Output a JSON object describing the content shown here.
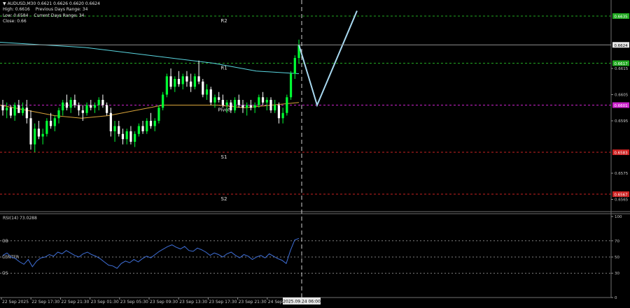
{
  "header": {
    "title": "AUDUSD,M30",
    "ohlc": "0.6621 0.6626 0.6620 0.6624",
    "high_label": "High: 0.6616",
    "prev_range_label": "Previous Days Range: 34",
    "low_label": "Low: 0.6584",
    "curr_range_label": "Current Days Range: 34",
    "close_label": "Close: 0.66"
  },
  "levels": [
    {
      "label": "R2",
      "price": 0.6635,
      "price_label": "0.6635",
      "color": "#22aa22"
    },
    {
      "label": "R1",
      "price": 0.6617,
      "price_label": "0.6617",
      "color": "#22aa22"
    },
    {
      "label": "Pivot",
      "price": 0.6601,
      "price_label": "0.6601",
      "color": "#cc22cc"
    },
    {
      "label": "S1",
      "price": 0.6583,
      "price_label": "0.6583",
      "color": "#cc2222"
    },
    {
      "label": "S2",
      "price": 0.6567,
      "price_label": "0.6567",
      "color": "#cc2222"
    }
  ],
  "current_price": {
    "value": 0.6624,
    "label": "0.6624"
  },
  "price_axis_ticks": [
    {
      "value": 0.6615,
      "label": "0.6615"
    },
    {
      "value": 0.6605,
      "label": "0.6605"
    },
    {
      "value": 0.6595,
      "label": "0.6595"
    },
    {
      "value": 0.6575,
      "label": "0.6575"
    },
    {
      "value": 0.6565,
      "label": "0.6565"
    }
  ],
  "time_axis": [
    "22 Sep 2025",
    "22 Sep 17:30",
    "22 Sep 21:30",
    "23 Sep 01:30",
    "23 Sep 05:30",
    "23 Sep 09:30",
    "23 Sep 13:30",
    "23 Sep 17:30",
    "23 Sep 21:30",
    "24 Sep"
  ],
  "cursor_time_label": "2025.09.24 06:00",
  "rsi": {
    "label": "RSI(14) 73.0288",
    "levels": [
      {
        "name": "OB",
        "value": 70
      },
      {
        "name": "CENTER",
        "value": 50
      },
      {
        "name": "OS",
        "value": 30
      }
    ],
    "axis_ticks": [
      100,
      70,
      50,
      30,
      0
    ]
  },
  "colors": {
    "bull": "#00ff33",
    "bear": "#ffffff",
    "ma_slow": "#5ad6e0",
    "ma_fast": "#d9a43a",
    "projection": "#a8d8f0",
    "rsi_line": "#3f6fd8",
    "cursor": "#d0d0d0"
  },
  "chart_data": {
    "type": "candlestick",
    "symbol": "AUDUSD",
    "timeframe": "M30",
    "ylim": [
      0.6561,
      0.664
    ],
    "candles": [
      [
        0.6601,
        0.6603,
        0.6597,
        0.6599
      ],
      [
        0.6599,
        0.6602,
        0.6596,
        0.66
      ],
      [
        0.66,
        0.6601,
        0.6596,
        0.6597
      ],
      [
        0.6597,
        0.6602,
        0.6595,
        0.6601
      ],
      [
        0.6601,
        0.6603,
        0.6598,
        0.6598
      ],
      [
        0.6598,
        0.6602,
        0.6597,
        0.66
      ],
      [
        0.66,
        0.6603,
        0.6594,
        0.6596
      ],
      [
        0.6596,
        0.6599,
        0.6584,
        0.6586
      ],
      [
        0.6586,
        0.6594,
        0.6583,
        0.6592
      ],
      [
        0.6592,
        0.6595,
        0.6588,
        0.6589
      ],
      [
        0.6589,
        0.6592,
        0.6586,
        0.659
      ],
      [
        0.659,
        0.6596,
        0.6589,
        0.6595
      ],
      [
        0.6595,
        0.6598,
        0.6592,
        0.6593
      ],
      [
        0.6593,
        0.6597,
        0.6591,
        0.6596
      ],
      [
        0.6596,
        0.66,
        0.6594,
        0.6599
      ],
      [
        0.6599,
        0.6603,
        0.6597,
        0.6602
      ],
      [
        0.6602,
        0.6605,
        0.6599,
        0.66
      ],
      [
        0.66,
        0.6604,
        0.6598,
        0.6603
      ],
      [
        0.6603,
        0.6605,
        0.66,
        0.6601
      ],
      [
        0.6601,
        0.6602,
        0.6597,
        0.6599
      ],
      [
        0.6599,
        0.6601,
        0.6595,
        0.6598
      ],
      [
        0.6598,
        0.6602,
        0.6597,
        0.6601
      ],
      [
        0.6601,
        0.6603,
        0.6599,
        0.66
      ],
      [
        0.66,
        0.6602,
        0.6598,
        0.6601
      ],
      [
        0.6601,
        0.6604,
        0.6599,
        0.6603
      ],
      [
        0.6603,
        0.6605,
        0.66,
        0.6601
      ],
      [
        0.6601,
        0.6602,
        0.6597,
        0.6598
      ],
      [
        0.6598,
        0.66,
        0.6589,
        0.6591
      ],
      [
        0.6591,
        0.6595,
        0.6587,
        0.6593
      ],
      [
        0.6593,
        0.6595,
        0.6589,
        0.659
      ],
      [
        0.659,
        0.6592,
        0.6586,
        0.6588
      ],
      [
        0.6588,
        0.6592,
        0.6586,
        0.6591
      ],
      [
        0.6591,
        0.6593,
        0.6586,
        0.6587
      ],
      [
        0.6587,
        0.6591,
        0.6585,
        0.659
      ],
      [
        0.659,
        0.6594,
        0.6589,
        0.6593
      ],
      [
        0.6593,
        0.6595,
        0.659,
        0.6591
      ],
      [
        0.6591,
        0.6596,
        0.659,
        0.6595
      ],
      [
        0.6595,
        0.6598,
        0.6592,
        0.6593
      ],
      [
        0.6593,
        0.6596,
        0.6591,
        0.6595
      ],
      [
        0.6595,
        0.6601,
        0.6594,
        0.66
      ],
      [
        0.66,
        0.6606,
        0.6599,
        0.6605
      ],
      [
        0.6605,
        0.6613,
        0.6604,
        0.6612
      ],
      [
        0.6612,
        0.6615,
        0.6607,
        0.6608
      ],
      [
        0.6608,
        0.6612,
        0.6606,
        0.6611
      ],
      [
        0.6611,
        0.6614,
        0.6608,
        0.6609
      ],
      [
        0.6609,
        0.6613,
        0.6607,
        0.6612
      ],
      [
        0.6612,
        0.6614,
        0.6608,
        0.661
      ],
      [
        0.661,
        0.6613,
        0.6606,
        0.6608
      ],
      [
        0.6608,
        0.6613,
        0.6607,
        0.6612
      ],
      [
        0.6612,
        0.6618,
        0.6609,
        0.661
      ],
      [
        0.661,
        0.6611,
        0.6604,
        0.6605
      ],
      [
        0.6605,
        0.6609,
        0.6603,
        0.6607
      ],
      [
        0.6607,
        0.6608,
        0.6601,
        0.6602
      ],
      [
        0.6602,
        0.6605,
        0.66,
        0.6604
      ],
      [
        0.6604,
        0.6606,
        0.6602,
        0.6603
      ],
      [
        0.6603,
        0.6605,
        0.66,
        0.6601
      ],
      [
        0.6601,
        0.6603,
        0.6598,
        0.6602
      ],
      [
        0.6602,
        0.6603,
        0.6598,
        0.6599
      ],
      [
        0.6599,
        0.6604,
        0.6598,
        0.6603
      ],
      [
        0.6603,
        0.6605,
        0.66,
        0.6601
      ],
      [
        0.6601,
        0.6603,
        0.6598,
        0.66
      ],
      [
        0.66,
        0.6602,
        0.6597,
        0.6601
      ],
      [
        0.6601,
        0.6603,
        0.6599,
        0.66
      ],
      [
        0.66,
        0.6602,
        0.6598,
        0.6601
      ],
      [
        0.6601,
        0.6605,
        0.66,
        0.6604
      ],
      [
        0.6604,
        0.6606,
        0.6601,
        0.6602
      ],
      [
        0.6602,
        0.6604,
        0.6599,
        0.6603
      ],
      [
        0.6603,
        0.6604,
        0.6598,
        0.6599
      ],
      [
        0.6599,
        0.6603,
        0.6598,
        0.6601
      ],
      [
        0.6601,
        0.6602,
        0.6594,
        0.6596
      ],
      [
        0.6596,
        0.66,
        0.6594,
        0.6598
      ],
      [
        0.6598,
        0.6605,
        0.6597,
        0.6604
      ],
      [
        0.6604,
        0.6614,
        0.6603,
        0.6613
      ],
      [
        0.6613,
        0.662,
        0.6611,
        0.6619
      ],
      [
        0.6619,
        0.6626,
        0.6617,
        0.6624
      ]
    ],
    "ma_slow": [
      0.6625,
      0.6624,
      0.6623,
      0.6621,
      0.6619,
      0.6617,
      0.6614,
      0.6613
    ],
    "ma_fast": [
      0.6601,
      0.6599,
      0.6597,
      0.6596,
      0.6597,
      0.6599,
      0.6601,
      0.6601,
      0.6601,
      0.66,
      0.6601,
      0.6602
    ],
    "projection": [
      0.6624,
      0.6601,
      0.6637
    ],
    "rsi_values": [
      52,
      55,
      50,
      48,
      44,
      41,
      47,
      38,
      45,
      49,
      50,
      53,
      51,
      56,
      54,
      58,
      55,
      52,
      50,
      54,
      56,
      53,
      51,
      48,
      44,
      40,
      39,
      36,
      42,
      45,
      43,
      47,
      44,
      48,
      51,
      49,
      53,
      57,
      60,
      63,
      65,
      62,
      60,
      63,
      58,
      57,
      61,
      59,
      56,
      52,
      55,
      53,
      50,
      54,
      56,
      52,
      49,
      53,
      51,
      47,
      50,
      52,
      49,
      54,
      51,
      48,
      46,
      42,
      58,
      71,
      73
    ]
  }
}
